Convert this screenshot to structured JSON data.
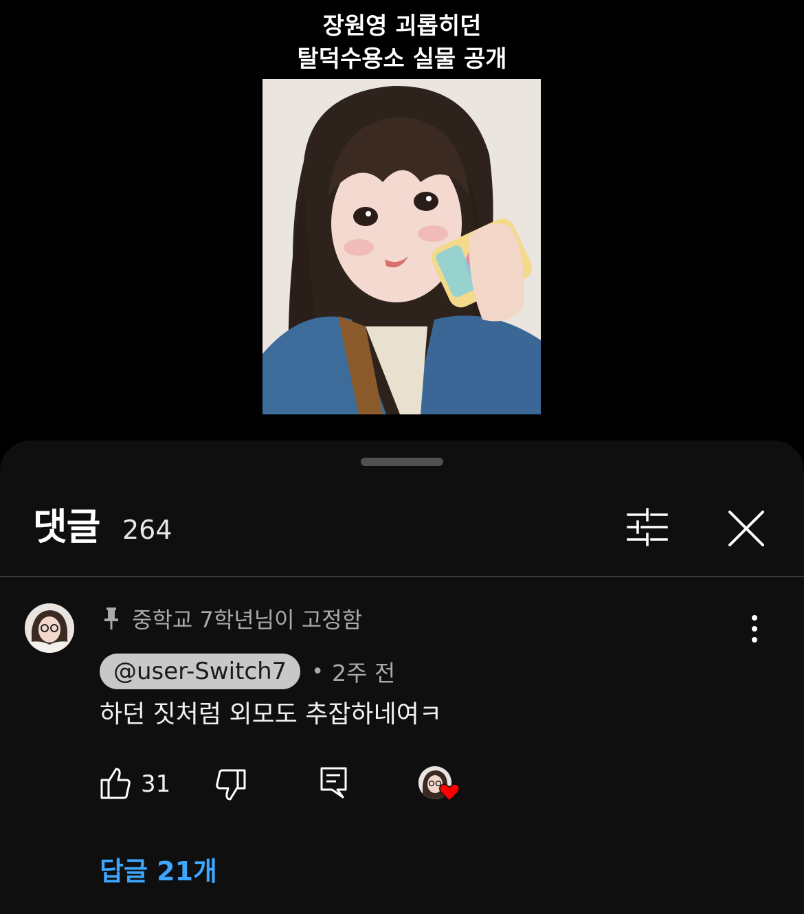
{
  "video": {
    "caption_line1": "장원영 괴롭히던",
    "caption_line2": "탈덕수용소 실물 공개"
  },
  "comments_sheet": {
    "title": "댓글",
    "count": "264",
    "filter_icon": "sliders-icon",
    "close_icon": "close-icon"
  },
  "comment": {
    "pinned_label": "중학교 7학년님이 고정함",
    "author": "@user-Switch7",
    "separator": "•",
    "time": "2주 전",
    "text": "하던 짓처럼 외모도 추잡하네여ㅋ",
    "like_count": "31",
    "icons": [
      "pin-icon",
      "more-vert-icon",
      "thumbs-up-icon",
      "thumbs-down-icon",
      "reply-icon",
      "heart-icon"
    ],
    "replies_label": "답글 21개"
  },
  "colors": {
    "background": "#000000",
    "sheet": "#0f0f0f",
    "link": "#3ea6ff",
    "author_chip": "#c8c8c8",
    "heart": "#ff0000"
  }
}
